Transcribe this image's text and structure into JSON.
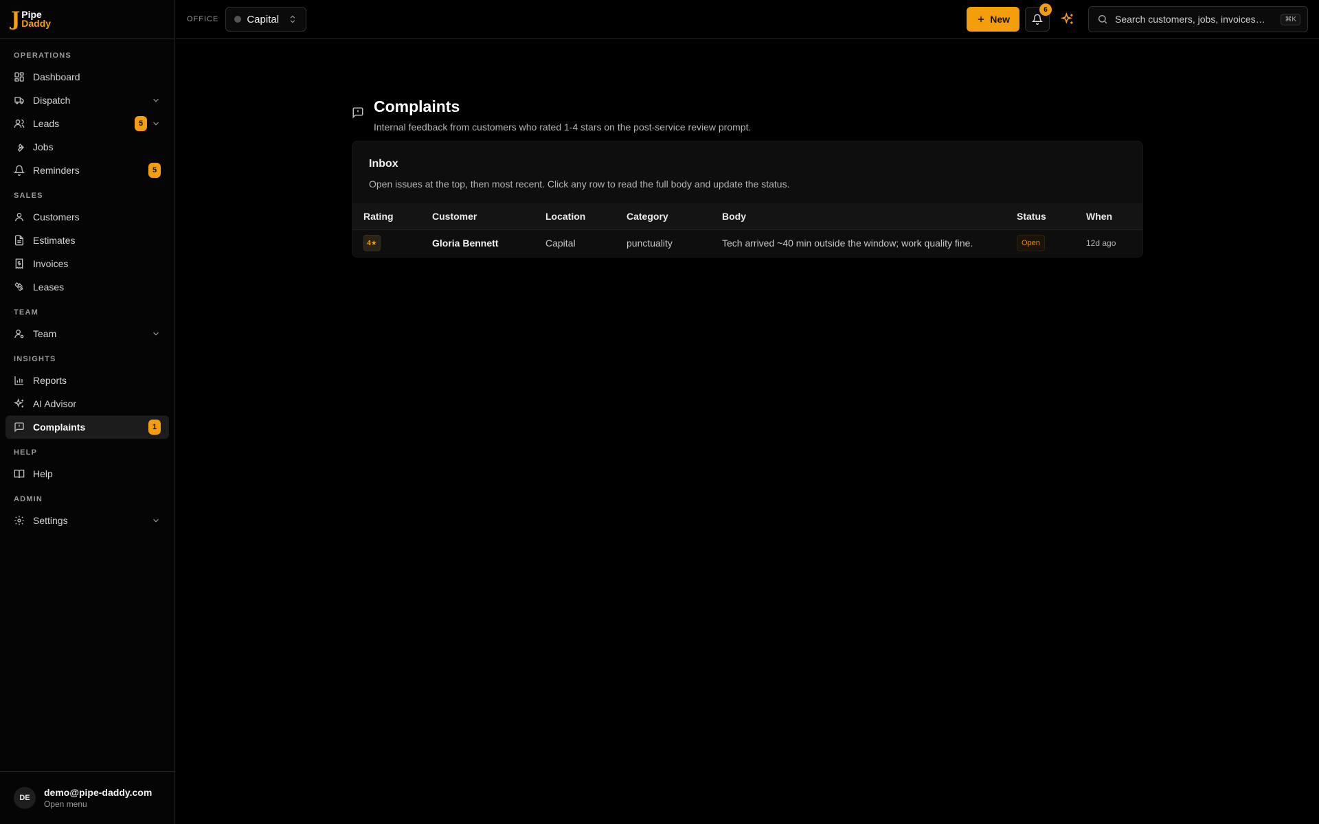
{
  "brand": {
    "line1": "Pipe",
    "line2": "Daddy",
    "mark": "J"
  },
  "sidebar": {
    "sections": [
      {
        "title": "OPERATIONS",
        "items": [
          {
            "label": "Dashboard",
            "icon": "dashboard-icon"
          },
          {
            "label": "Dispatch",
            "icon": "truck-icon",
            "chevron": true
          },
          {
            "label": "Leads",
            "icon": "users-icon",
            "badge": "5",
            "chevron": true
          },
          {
            "label": "Jobs",
            "icon": "wrench-icon"
          },
          {
            "label": "Reminders",
            "icon": "bell-icon",
            "badge": "5"
          }
        ]
      },
      {
        "title": "SALES",
        "items": [
          {
            "label": "Customers",
            "icon": "user-icon"
          },
          {
            "label": "Estimates",
            "icon": "file-text-icon"
          },
          {
            "label": "Invoices",
            "icon": "receipt-icon"
          },
          {
            "label": "Leases",
            "icon": "handshake-icon"
          }
        ]
      },
      {
        "title": "TEAM",
        "items": [
          {
            "label": "Team",
            "icon": "user-icon",
            "chevron": true
          }
        ]
      },
      {
        "title": "INSIGHTS",
        "items": [
          {
            "label": "Reports",
            "icon": "bar-chart-icon"
          },
          {
            "label": "AI Advisor",
            "icon": "sparkle-icon"
          },
          {
            "label": "Complaints",
            "icon": "message-square-icon",
            "badge": "1",
            "active": true
          }
        ]
      },
      {
        "title": "HELP",
        "items": [
          {
            "label": "Help",
            "icon": "book-icon"
          }
        ]
      },
      {
        "title": "ADMIN",
        "items": [
          {
            "label": "Settings",
            "icon": "gear-icon",
            "chevron": true
          }
        ]
      }
    ]
  },
  "user": {
    "initials": "DE",
    "email": "demo@pipe-daddy.com",
    "menu_label": "Open menu"
  },
  "topbar": {
    "office_label": "OFFICE",
    "office_value": "Capital",
    "new_label": "New",
    "notifications_count": "6",
    "search_placeholder": "Search customers, jobs, invoices…",
    "search_shortcut": "⌘K"
  },
  "page": {
    "title": "Complaints",
    "subtitle": "Internal feedback from customers who rated 1-4 stars on the post-service review prompt."
  },
  "inbox": {
    "title": "Inbox",
    "description": "Open issues at the top, then most recent. Click any row to read the full body and update the status.",
    "columns": [
      "Rating",
      "Customer",
      "Location",
      "Category",
      "Body",
      "Status",
      "When"
    ],
    "rows": [
      {
        "rating": "4★",
        "customer": "Gloria Bennett",
        "location": "Capital",
        "category": "punctuality",
        "body": "Tech arrived ~40 min outside the window; work quality fine.",
        "status": "Open",
        "when": "12d ago"
      }
    ]
  },
  "colors": {
    "accent": "#f59e0b",
    "background": "#000000"
  }
}
